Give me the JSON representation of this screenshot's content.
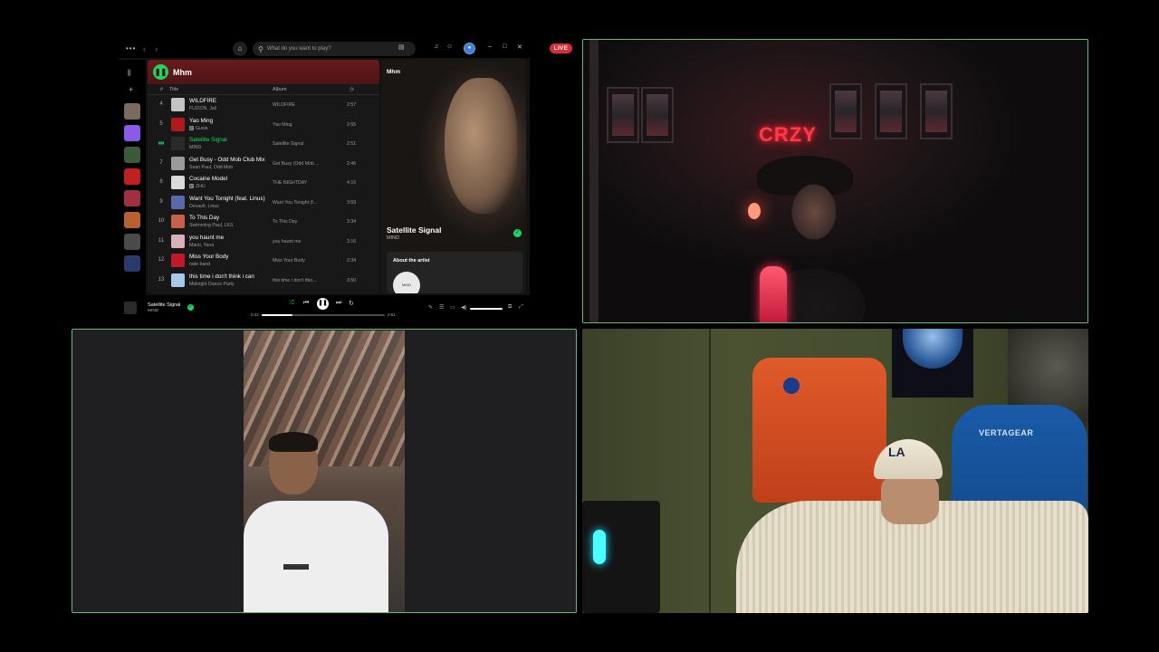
{
  "live_badge": "LIVE",
  "spotify": {
    "search_placeholder": "What do you want to play?",
    "playlist_title": "Mhm",
    "columns": {
      "number": "#",
      "title": "Title",
      "album": "Album"
    },
    "tracks": [
      {
        "num": "4",
        "title": "WILDFIRE",
        "artist": "FUZION, Jall",
        "album": "WILDFIRE",
        "duration": "2:57",
        "art": "#c4c4c4"
      },
      {
        "num": "5",
        "title": "Yao Ming",
        "artist": "Gusla",
        "album": "Yao Ming",
        "duration": "2:55",
        "art": "#b01a1a",
        "explicit": "E"
      },
      {
        "num": "",
        "title": "Satellite Signal",
        "artist": "MIND",
        "album": "Satellite Signal",
        "duration": "2:51",
        "art": "#2a2a2a",
        "active": true
      },
      {
        "num": "7",
        "title": "Get Busy - Odd Mob Club Mix",
        "artist": "Sean Paul, Odd Mob",
        "album": "Get Busy (Odd Mob ...",
        "duration": "2:46",
        "art": "#9a9a9a"
      },
      {
        "num": "8",
        "title": "Cocaine Model",
        "artist": "ZHU",
        "album": "THE NIGHTDAY",
        "duration": "4:16",
        "art": "#dadada",
        "explicit": "E"
      },
      {
        "num": "9",
        "title": "Want You Tonight (feat. Linus)",
        "artist": "Devault, Linus",
        "album": "Want You Tonight (f...",
        "duration": "3:59",
        "art": "#5a6aa8"
      },
      {
        "num": "10",
        "title": "To This Day",
        "artist": "Swimming Paul, LKS",
        "album": "To This Day",
        "duration": "3:34",
        "art": "#c8604a"
      },
      {
        "num": "11",
        "title": "you haunt me",
        "artist": "Marzi, Yana",
        "album": "you haunt me",
        "duration": "3:16",
        "art": "#d8b0b8"
      },
      {
        "num": "12",
        "title": "Miss Your Body",
        "artist": "nate band",
        "album": "Miss Your Body",
        "duration": "2:34",
        "art": "#c01a2a"
      },
      {
        "num": "13",
        "title": "this time i don't think i can",
        "artist": "Midnight Dance Party",
        "album": "this time i don't thin...",
        "duration": "3:50",
        "art": "#a8c8e8"
      }
    ],
    "right_panel": {
      "playlist_label": "Mhm",
      "track_title": "Satellite Signal",
      "track_artist": "MIND",
      "about_label": "About the artist",
      "artist_logo": "MIND"
    },
    "now_playing": {
      "title": "Satellite Signal",
      "artist": "MIND",
      "elapsed": "0:42",
      "total": "2:51",
      "progress_fraction": 0.25
    },
    "sidebar_thumb_colors": [
      "#7a6a60",
      "#8a5ae8",
      "#3a5a3a",
      "#c02020",
      "#a03040",
      "#b86030",
      "#4a4a4a",
      "#2a3a6a"
    ]
  },
  "cam1": {
    "neon_sign": "CRZY"
  },
  "cam3": {
    "chair_brand": "VERTAGEAR",
    "cap_logo": "LA"
  }
}
